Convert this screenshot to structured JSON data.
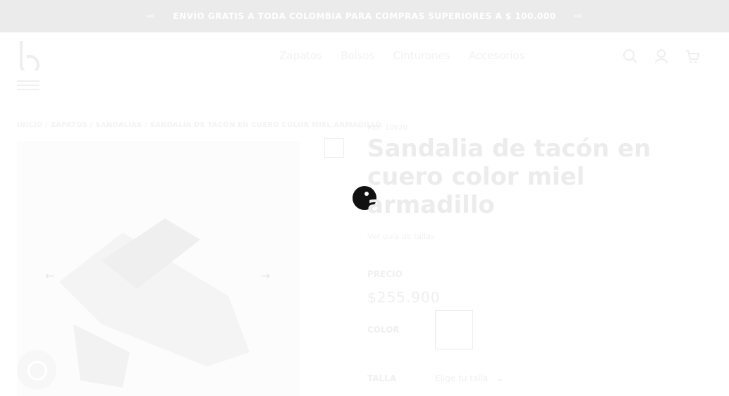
{
  "topbar": {
    "message": "ENVÍO GRATIS A TODA COLOMBIA PARA COMPRAS SUPERIORES A $ 100.000"
  },
  "header": {
    "nav": [
      "Zapatos",
      "Bolsos",
      "Cinturones",
      "Accesorios"
    ]
  },
  "breadcrumb": {
    "items": [
      "INICIO",
      "ZAPATOS",
      "SANDALIAS"
    ],
    "current": "SANDALIA DE TACÓN EN CUERO COLOR MIEL ARMADILLO",
    "sep": " / "
  },
  "product": {
    "ref": "REF: 10920",
    "title": "Sandalia de tacón en cuero color miel armadillo",
    "subtitle": "Ver guía de tallas",
    "price_label": "PRECIO",
    "price": "$255.900",
    "color_label": "COLOR",
    "size_label": "TALLA",
    "size_placeholder": "Elige tu talla"
  }
}
